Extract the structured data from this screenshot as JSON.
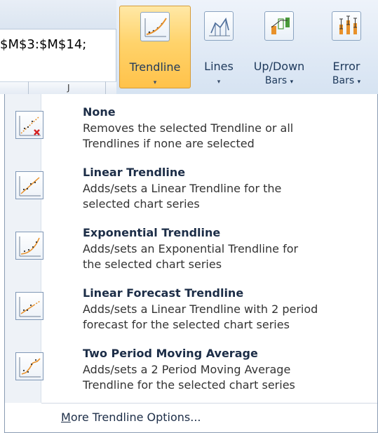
{
  "formula_bar": {
    "text": "$M$3:$M$14;"
  },
  "grid": {
    "column_label": "J"
  },
  "ribbon": {
    "buttons": [
      {
        "id": "trendline",
        "label": "Trendline",
        "icon": "trendline-icon",
        "state": "pressed"
      },
      {
        "id": "lines",
        "label": "Lines",
        "icon": "lines-icon"
      },
      {
        "id": "updown",
        "label_line1": "Up/Down",
        "label_line2": "Bars",
        "icon": "up-down-bars-icon"
      },
      {
        "id": "error",
        "label_line1": "Error",
        "label_line2": "Bars",
        "icon": "error-bars-icon"
      }
    ],
    "dropdown_arrow": "▾",
    "highlight_color": "#ffd36b"
  },
  "menu": {
    "items": [
      {
        "title": "None",
        "desc_line1": "Removes the selected Trendline or all",
        "desc_line2": "Trendlines if none are selected",
        "icon": "trendline-none-icon"
      },
      {
        "title": "Linear Trendline",
        "desc_line1": "Adds/sets a Linear Trendline for the",
        "desc_line2": "selected chart series",
        "icon": "linear-trendline-icon"
      },
      {
        "title": "Exponential Trendline",
        "desc_line1": "Adds/sets an Exponential Trendline for",
        "desc_line2": "the selected chart series",
        "icon": "exponential-trendline-icon"
      },
      {
        "title": "Linear Forecast Trendline",
        "desc_line1": "Adds/sets a Linear Trendline with 2 period",
        "desc_line2": "forecast for the selected chart series",
        "icon": "linear-forecast-trendline-icon"
      },
      {
        "title": "Two Period Moving Average",
        "desc_line1": "Adds/sets a 2 Period Moving Average",
        "desc_line2": "Trendline for the selected chart series",
        "icon": "moving-average-trendline-icon"
      }
    ],
    "more_options": {
      "accel": "M",
      "rest": "ore Trendline Options..."
    }
  }
}
